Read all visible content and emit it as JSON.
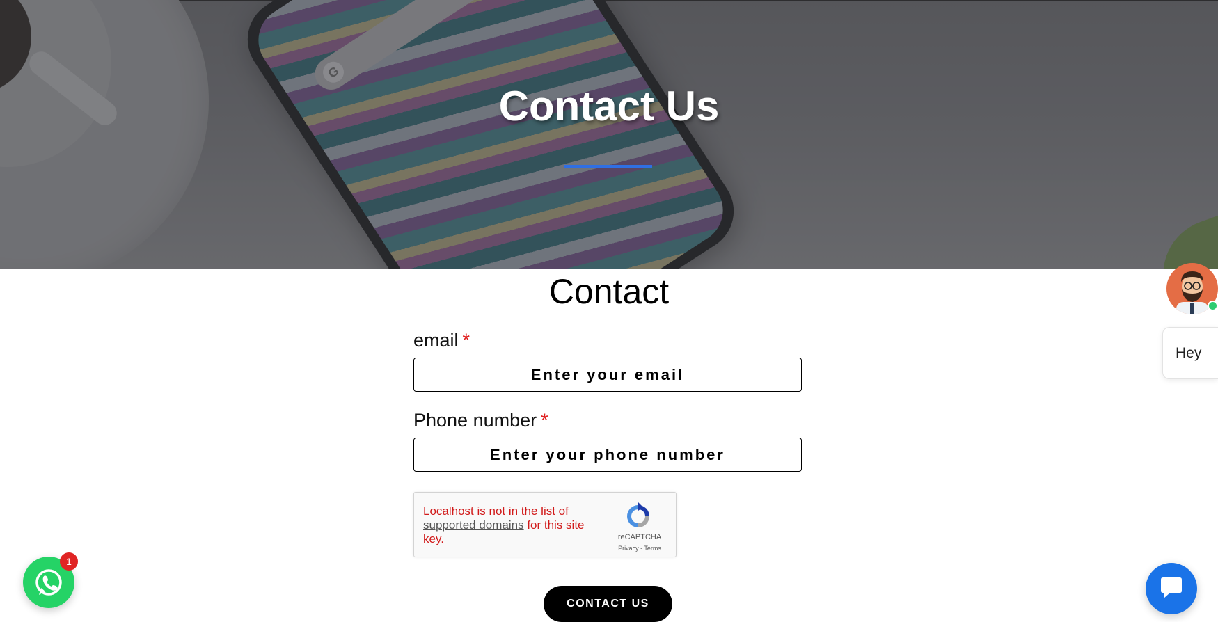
{
  "hero": {
    "title": "Contact Us"
  },
  "form": {
    "title": "Contact",
    "email": {
      "label": "email",
      "required_mark": "*",
      "placeholder": "Enter your email",
      "value": ""
    },
    "phone": {
      "label": "Phone number",
      "required_mark": "*",
      "placeholder": "Enter your phone number",
      "value": ""
    },
    "recaptcha": {
      "error_before": "Localhost is not in the list of ",
      "error_link": "supported domains",
      "error_after": " for this site key.",
      "brand": "reCAPTCHA",
      "privacy": "Privacy",
      "separator": " - ",
      "terms": "Terms"
    },
    "submit_label": "CONTACT US"
  },
  "widgets": {
    "whatsapp_badge": "1",
    "greeting": "Hey",
    "icons": [
      "whatsapp-icon",
      "agent-avatar",
      "chat-icon",
      "recaptcha-icon"
    ]
  },
  "colors": {
    "accent_blue": "#2f6fe3",
    "required_red": "#e02020",
    "whatsapp_green": "#25d366",
    "chat_blue": "#1a73e8",
    "avatar_orange": "#e46d45"
  }
}
